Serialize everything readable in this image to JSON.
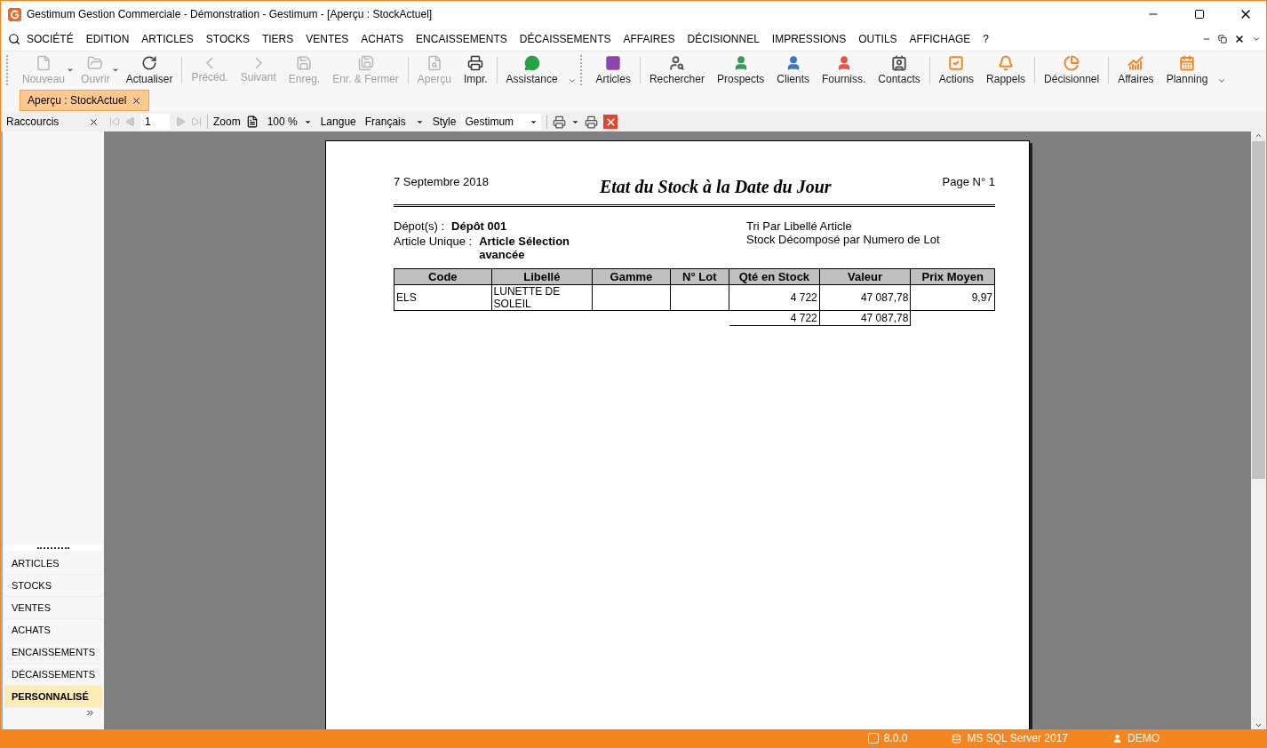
{
  "window": {
    "title": "Gestimum Gestion Commerciale - Démonstration - Gestimum - [Aperçu : StockActuel]"
  },
  "menu": [
    "SOCIÉTÉ",
    "EDITION",
    "ARTICLES",
    "STOCKS",
    "TIERS",
    "VENTES",
    "ACHATS",
    "ENCAISSEMENTS",
    "DÉCAISSEMENTS",
    "AFFAIRES",
    "DÉCISIONNEL",
    "IMPRESSIONS",
    "OUTILS",
    "AFFICHAGE",
    "?"
  ],
  "toolbar": [
    [
      {
        "label": "Nouveau",
        "disabled": true,
        "dropdown": true
      },
      {
        "label": "Ouvrir",
        "disabled": true,
        "dropdown": true
      },
      {
        "label": "Actualiser",
        "disabled": false,
        "dropdown": false
      }
    ],
    [
      {
        "label": "Précéd.",
        "disabled": true,
        "dropdown": false
      },
      {
        "label": "Suivant",
        "disabled": true,
        "dropdown": false
      },
      {
        "label": "Enreg.",
        "disabled": true,
        "dropdown": false
      },
      {
        "label": "Enr. & Fermer",
        "disabled": true,
        "dropdown": false
      }
    ],
    [
      {
        "label": "Aperçu",
        "disabled": true,
        "dropdown": false
      },
      {
        "label": "Impr.",
        "disabled": false,
        "dropdown": false
      }
    ],
    [
      {
        "label": "Assistance",
        "disabled": false,
        "dropdown": false
      }
    ]
  ],
  "shortcut_bar": [
    [
      {
        "label": "Articles",
        "color": "#8e44ad"
      }
    ],
    [
      {
        "label": "Rechercher",
        "color": "#555555"
      },
      {
        "label": "Prospects",
        "color": "#3a9a5b"
      },
      {
        "label": "Clients",
        "color": "#3b78c2"
      },
      {
        "label": "Fourniss.",
        "color": "#e0584a"
      },
      {
        "label": "Contacts",
        "color": "#555555"
      }
    ],
    [
      {
        "label": "Actions",
        "color": "#f5861f"
      },
      {
        "label": "Rappels",
        "color": "#f5861f"
      }
    ],
    [
      {
        "label": "Décisionnel",
        "color": "#f5861f"
      }
    ],
    [
      {
        "label": "Affaires",
        "color": "#f5861f"
      },
      {
        "label": "Planning",
        "color": "#f5861f"
      }
    ]
  ],
  "tabs": [
    {
      "label": "Aperçu : StockActuel",
      "selected": true
    }
  ],
  "preview_toolbar": {
    "panel_title": "Raccourcis",
    "page": "1",
    "zoom_label": "Zoom",
    "zoom": "100 %",
    "language_label": "Langue",
    "language": "Français",
    "style_label": "Style",
    "style": "Gestimum"
  },
  "sidebar": {
    "items": [
      {
        "label": "ARTICLES",
        "selected": false
      },
      {
        "label": "STOCKS",
        "selected": false
      },
      {
        "label": "VENTES",
        "selected": false
      },
      {
        "label": "ACHATS",
        "selected": false
      },
      {
        "label": "ENCAISSEMENTS",
        "selected": false
      },
      {
        "label": "DÉCAISSEMENTS",
        "selected": false
      },
      {
        "label": "PERSONNALISÉ",
        "selected": true
      }
    ]
  },
  "report": {
    "date": "7 Septembre 2018",
    "title": "Etat du Stock à la Date du Jour",
    "page": "Page N° 1",
    "filters": [
      {
        "label": "Dépot(s) :",
        "value": "Dépôt 001"
      },
      {
        "label": "Article Unique :",
        "value": "Article Sélection avancée"
      }
    ],
    "notes": [
      "Tri Par Libellé Article",
      "Stock Décomposé par Numero de Lot"
    ],
    "columns": [
      "Code",
      "Libellé",
      "Gamme",
      "N° Lot",
      "Qté en Stock",
      "Valeur",
      "Prix Moyen"
    ],
    "rows": [
      [
        "ELS",
        "LUNETTE DE SOLEIL",
        "",
        "",
        "4 722",
        "47 087,78",
        "9,97"
      ]
    ],
    "totals": {
      "quantity": "4 722",
      "value": "47 087,78"
    }
  },
  "status_bar": {
    "version": "8.0.0",
    "server": "MS SQL Server 2017",
    "user": "DEMO"
  }
}
